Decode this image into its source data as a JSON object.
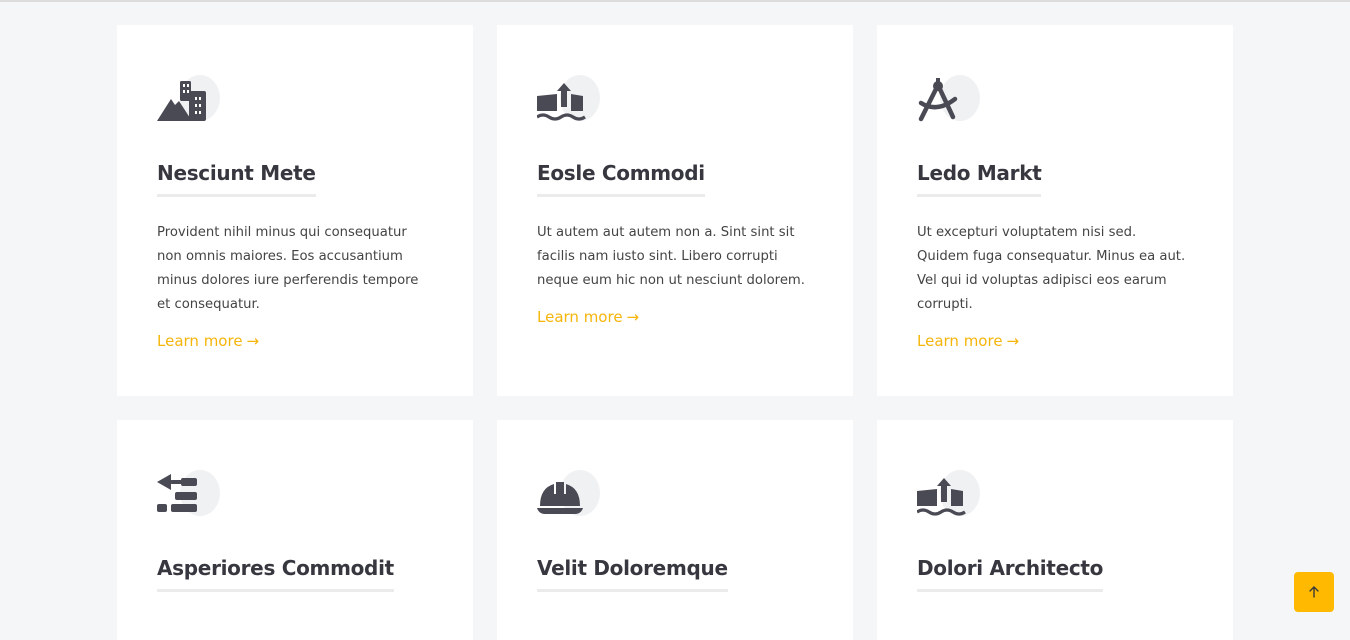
{
  "services": [
    {
      "icon": "mountain-city-icon",
      "title": "Nesciunt Mete",
      "text": "Provident nihil minus qui consequatur non omnis maiores. Eos accusantium minus dolores iure perferendis tempore et consequatur.",
      "link": "Learn more"
    },
    {
      "icon": "arrow-up-from-ground-water-icon",
      "title": "Eosle Commodi",
      "text": "Ut autem aut autem non a. Sint sint sit facilis nam iusto sint. Libero corrupti neque eum hic non ut nesciunt dolorem.",
      "link": "Learn more"
    },
    {
      "icon": "compass-drafting-icon",
      "title": "Ledo Markt",
      "text": "Ut excepturi voluptatem nisi sed. Quidem fuga consequatur. Minus ea aut. Vel qui id voluptas adipisci eos earum corrupti.",
      "link": "Learn more"
    },
    {
      "icon": "trowel-bricks-icon",
      "title": "Asperiores Commodit",
      "text": "",
      "link": ""
    },
    {
      "icon": "helmet-safety-icon",
      "title": "Velit Doloremque",
      "text": "",
      "link": ""
    },
    {
      "icon": "arrow-up-from-ground-water-icon",
      "title": "Dolori Architecto",
      "text": "",
      "link": ""
    }
  ],
  "link_arrow": "→",
  "scroll_top_icon": "arrow-up-icon",
  "colors": {
    "accent": "#feb900",
    "link": "#f5b50a",
    "heading": "#37373f",
    "icon": "#4a4a55",
    "background": "#f5f6f7"
  }
}
